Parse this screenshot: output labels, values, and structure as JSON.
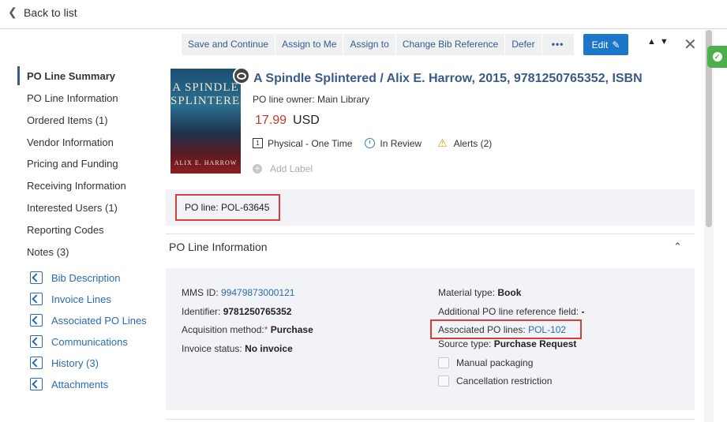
{
  "topbar": {
    "back_label": "Back to list"
  },
  "toolbar": {
    "buttons": [
      "Save and Continue",
      "Assign to Me",
      "Assign to",
      "Change Bib Reference",
      "Defer"
    ],
    "more_label": "•••",
    "edit_label": "Edit"
  },
  "sidebar": {
    "items": [
      {
        "label": "PO Line Summary",
        "count": ""
      },
      {
        "label": "PO Line Information",
        "count": ""
      },
      {
        "label": "Ordered Items",
        "count": "(1)"
      },
      {
        "label": "Vendor Information",
        "count": ""
      },
      {
        "label": "Pricing and Funding",
        "count": ""
      },
      {
        "label": "Receiving Information",
        "count": ""
      },
      {
        "label": "Interested Users",
        "count": "(1)"
      },
      {
        "label": "Reporting Codes",
        "count": ""
      },
      {
        "label": "Notes",
        "count": "(3)"
      }
    ],
    "links": [
      "Bib Description",
      "Invoice Lines",
      "Associated PO Lines",
      "Communications",
      "History (3)",
      "Attachments"
    ]
  },
  "summary": {
    "cover_title": "A SPINDLE SPLINTERED",
    "cover_author": "ALIX E. HARROW",
    "title": "A Spindle Splintered / Alix E. Harrow, 2015, 9781250765352, ISBN",
    "owner": "PO line owner: Main Library",
    "price": "17.99",
    "currency": "USD",
    "type_num": "1",
    "type": "Physical - One Time",
    "status": "In Review",
    "alerts": "Alerts (2)",
    "add_label": "Add Label",
    "po_line": "PO line: POL-63645"
  },
  "po_info": {
    "section_title": "PO Line Information",
    "mms_label": "MMS ID:",
    "mms_value": "99479873000121",
    "identifier_label": "Identifier:",
    "identifier_value": "9781250765352",
    "acq_label": "Acquisition method:",
    "acq_req": "*",
    "acq_value": "Purchase",
    "invoice_label": "Invoice status:",
    "invoice_value": "No invoice",
    "material_label": "Material type:",
    "material_value": "Book",
    "additional_label": "Additional PO line reference field:",
    "additional_value": "-",
    "assoc_label": "Associated PO lines:",
    "assoc_value": "POL-102",
    "source_label": "Source type:",
    "source_value": "Purchase Request",
    "manual_packaging": "Manual packaging",
    "cancellation": "Cancellation restriction"
  },
  "colors": {
    "accent": "#3a5a8a",
    "edit_button": "#1d77c9",
    "highlight": "#d43f3a",
    "price": "#c0392b"
  }
}
